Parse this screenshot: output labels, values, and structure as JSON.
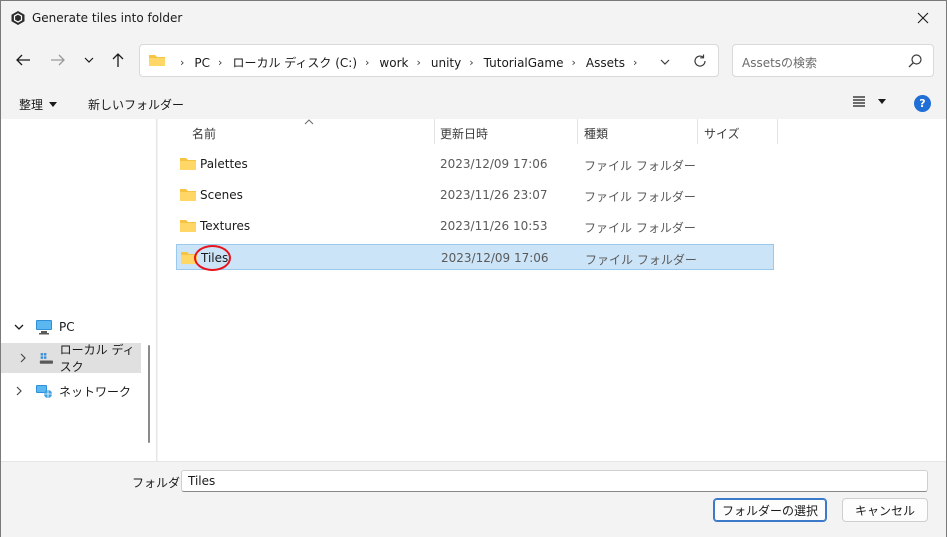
{
  "window": {
    "title": "Generate tiles into folder"
  },
  "address": {
    "crumbs": [
      "PC",
      "ローカル ディスク (C:)",
      "work",
      "unity",
      "TutorialGame",
      "Assets"
    ]
  },
  "search": {
    "placeholder": "Assetsの検索"
  },
  "toolbar": {
    "organize": "整理",
    "new_folder": "新しいフォルダー"
  },
  "nav": {
    "items": [
      {
        "label": "PC"
      },
      {
        "label": "ローカル ディスク"
      },
      {
        "label": "ネットワーク"
      }
    ]
  },
  "list": {
    "columns": {
      "name": "名前",
      "modified": "更新日時",
      "type": "種類",
      "size": "サイズ"
    },
    "rows": [
      {
        "name": "Palettes",
        "modified": "2023/12/09 17:06",
        "type": "ファイル フォルダー"
      },
      {
        "name": "Scenes",
        "modified": "2023/11/26 23:07",
        "type": "ファイル フォルダー"
      },
      {
        "name": "Textures",
        "modified": "2023/11/26 10:53",
        "type": "ファイル フォルダー"
      },
      {
        "name": "Tiles",
        "modified": "2023/12/09 17:06",
        "type": "ファイル フォルダー"
      }
    ]
  },
  "footer": {
    "folder_label": "フォルダー:",
    "folder_value": "Tiles",
    "select_button": "フォルダーの選択",
    "cancel_button": "キャンセル"
  },
  "colors": {
    "accent": "#1f6fd6",
    "selection": "#cce4f7",
    "annotation": "#e8131b",
    "folder": "#f6c343"
  }
}
